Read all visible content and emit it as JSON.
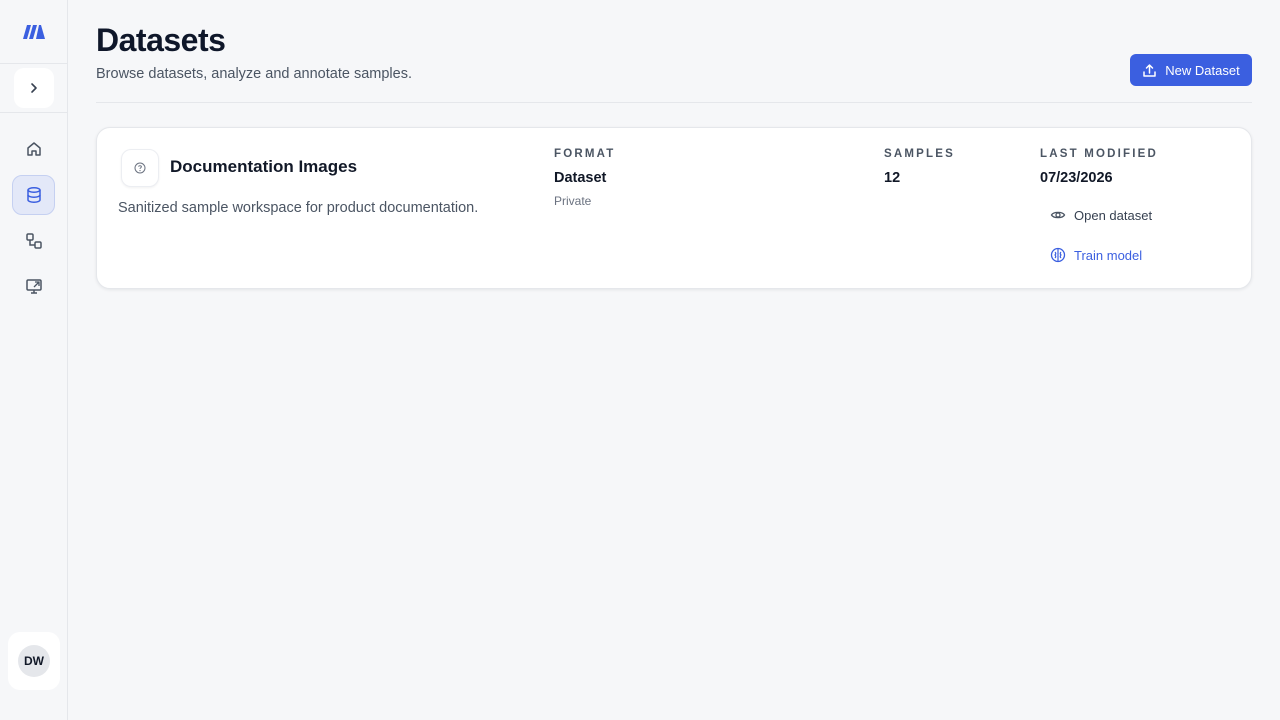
{
  "header": {
    "title": "Datasets",
    "subtitle": "Browse datasets, analyze and annotate samples.",
    "new_button_label": "New Dataset"
  },
  "sidebar": {
    "items": [
      {
        "name": "home",
        "icon": "home-icon",
        "active": false
      },
      {
        "name": "datasets",
        "icon": "database-icon",
        "active": true
      },
      {
        "name": "workflows",
        "icon": "workflow-icon",
        "active": false
      },
      {
        "name": "deploy",
        "icon": "monitor-icon",
        "active": false
      }
    ],
    "user_initials": "DW"
  },
  "dataset": {
    "name": "Documentation Images",
    "description": "Sanitized sample workspace for product documentation.",
    "format_label": "FORMAT",
    "format_value": "Dataset",
    "visibility": "Private",
    "samples_label": "SAMPLES",
    "samples_value": "12",
    "modified_label": "LAST MODIFIED",
    "modified_value": "07/23/2026",
    "open_label": "Open dataset",
    "train_label": "Train model"
  },
  "colors": {
    "accent": "#3b5fe0",
    "active_nav_bg": "#e3e8f8",
    "page_bg": "#f6f7f9"
  }
}
